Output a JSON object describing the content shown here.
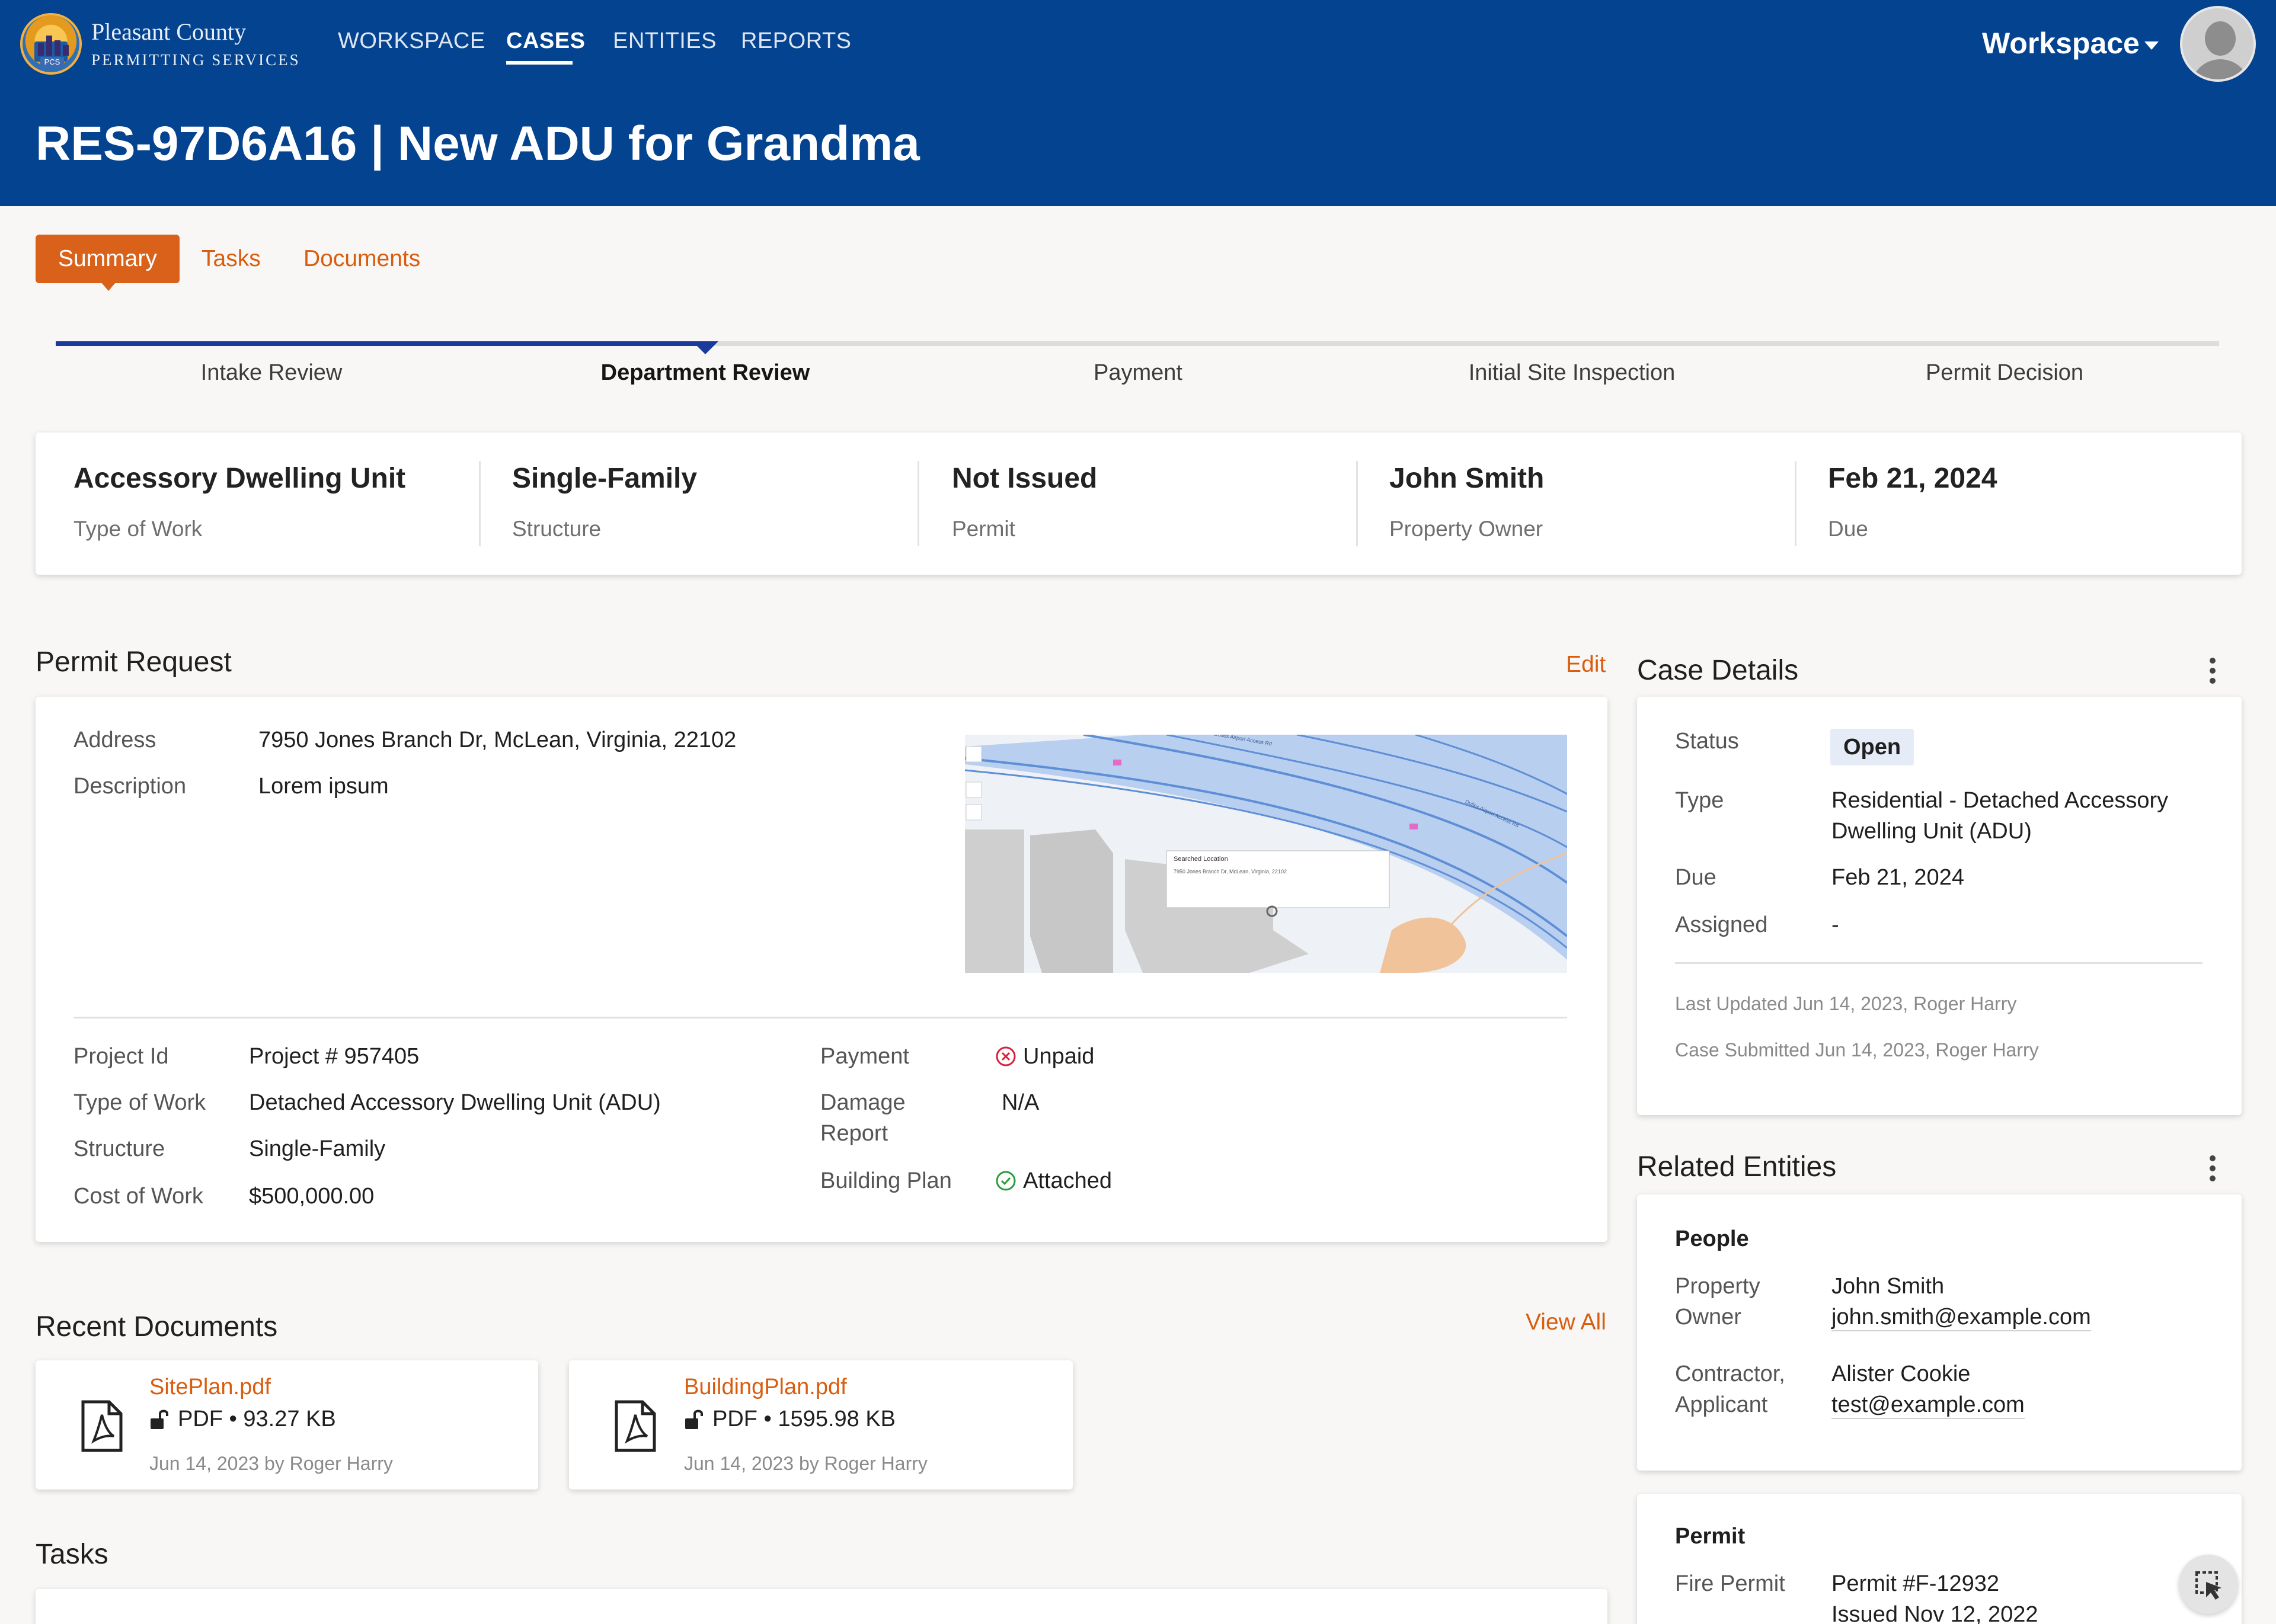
{
  "header": {
    "logo_line1": "Pleasant County",
    "logo_line2": "PERMITTING SERVICES",
    "logo_badge_text": "PCS",
    "nav": [
      {
        "label": "WORKSPACE",
        "active": false
      },
      {
        "label": "CASES",
        "active": true
      },
      {
        "label": "ENTITIES",
        "active": false
      },
      {
        "label": "REPORTS",
        "active": false
      }
    ],
    "workspace_label": "Workspace",
    "page_title": "RES-97D6A16 | New ADU for Grandma"
  },
  "tabs": [
    {
      "label": "Summary",
      "active": true
    },
    {
      "label": "Tasks",
      "active": false
    },
    {
      "label": "Documents",
      "active": false
    }
  ],
  "progress": {
    "stages": [
      "Intake Review",
      "Department Review",
      "Payment",
      "Initial Site Inspection",
      "Permit Decision"
    ],
    "current_index": 1
  },
  "summary": [
    {
      "value": "Accessory Dwelling Unit",
      "label": "Type of Work"
    },
    {
      "value": "Single-Family",
      "label": "Structure"
    },
    {
      "value": "Not Issued",
      "label": "Permit"
    },
    {
      "value": "John Smith",
      "label": "Property Owner"
    },
    {
      "value": "Feb 21, 2024",
      "label": "Due"
    }
  ],
  "permit_request": {
    "title": "Permit Request",
    "edit_label": "Edit",
    "address_label": "Address",
    "address": "7950 Jones Branch Dr, McLean, Virginia, 22102",
    "description_label": "Description",
    "description": "Lorem ipsum",
    "map": {
      "popup_title": "Searched Location",
      "popup_address": "7950 Jones Branch Dr, McLean, Virginia, 22102",
      "road_label": "Dulles Airport Access Rd"
    },
    "fields_left": [
      {
        "label": "Project Id",
        "value": "Project # 957405"
      },
      {
        "label": "Type of Work",
        "value": "Detached Accessory Dwelling Unit (ADU)"
      },
      {
        "label": "Structure",
        "value": "Single-Family"
      },
      {
        "label": "Cost of Work",
        "value": "$500,000.00"
      }
    ],
    "payment_label": "Payment",
    "payment_value": "Unpaid",
    "damage_label_1": "Damage",
    "damage_label_2": "Report",
    "damage_value": "N/A",
    "building_plan_label": "Building Plan",
    "building_plan_value": "Attached"
  },
  "case_details": {
    "title": "Case Details",
    "status_label": "Status",
    "status_value": "Open",
    "type_label": "Type",
    "type_value_1": "Residential - Detached Accessory",
    "type_value_2": "Dwelling Unit (ADU)",
    "due_label": "Due",
    "due_value": "Feb 21, 2024",
    "assigned_label": "Assigned",
    "assigned_value": "-",
    "last_updated": "Last Updated Jun 14, 2023, Roger Harry",
    "case_submitted": "Case Submitted Jun 14, 2023, Roger Harry"
  },
  "related_entities": {
    "title": "Related Entities",
    "people_heading": "People",
    "owner_label_1": "Property",
    "owner_label_2": "Owner",
    "owner_name": "John Smith",
    "owner_email": "john.smith@example.com",
    "contractor_label_1": "Contractor,",
    "contractor_label_2": "Applicant",
    "contractor_name": "Alister Cookie",
    "contractor_email": "test@example.com",
    "permit_heading": "Permit",
    "fire_permit_label": "Fire Permit",
    "fire_permit_value": "Permit #F-12932",
    "fire_permit_issued": "Issued Nov 12, 2022"
  },
  "recent_documents": {
    "title": "Recent Documents",
    "view_all": "View All",
    "docs": [
      {
        "name": "SitePlan.pdf",
        "meta": "PDF • 93.27 KB",
        "date": "Jun 14, 2023 by Roger Harry"
      },
      {
        "name": "BuildingPlan.pdf",
        "meta": "PDF • 1595.98 KB",
        "date": "Jun 14, 2023 by Roger Harry"
      }
    ]
  },
  "tasks": {
    "title": "Tasks"
  },
  "colors": {
    "header_blue": "#04438f",
    "accent_orange": "#d9611a",
    "progress_blue": "#1a3a9c",
    "status_chip": "#e6ecf7",
    "unpaid_red": "#d6233c",
    "attached_green": "#2a9d3a"
  },
  "icons": [
    "logo-badge",
    "chevron-down-icon",
    "user-avatar-icon",
    "unpaid-x-circle-icon",
    "check-circle-icon",
    "kebab-menu-icon",
    "pdf-file-icon",
    "unlock-icon",
    "cursor-select-icon"
  ]
}
